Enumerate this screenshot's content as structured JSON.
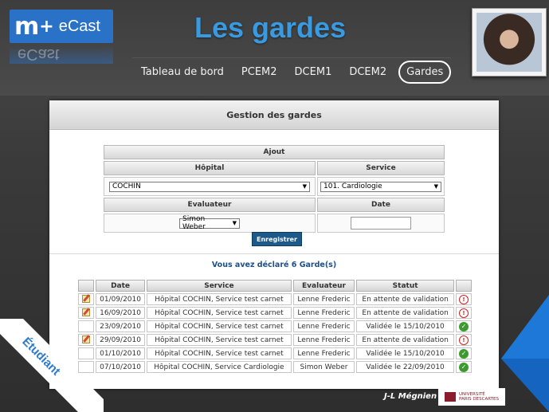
{
  "header": {
    "logo_text": "eCast",
    "slide_title": "Les gardes"
  },
  "nav": {
    "items": [
      {
        "label": "Tableau de bord",
        "active": false
      },
      {
        "label": "PCEM2",
        "active": false
      },
      {
        "label": "DCEM1",
        "active": false
      },
      {
        "label": "DCEM2",
        "active": false
      },
      {
        "label": "Gardes",
        "active": true
      }
    ]
  },
  "panel": {
    "title": "Gestion des gardes",
    "form": {
      "section_title": "Ajout",
      "hospital_label": "Hôpital",
      "hospital_value": "COCHIN",
      "service_label": "Service",
      "service_value": "101. Cardiologie",
      "evaluator_label": "Evaluateur",
      "evaluator_value": "Simon Weber",
      "date_label": "Date",
      "date_value": "",
      "save_label": "Enregistrer"
    },
    "declared_text": "Vous avez déclaré 6 Garde(s)",
    "table": {
      "headers": [
        "",
        "Date",
        "Service",
        "Evaluateur",
        "Statut",
        ""
      ],
      "rows": [
        {
          "editable": true,
          "date": "01/09/2010",
          "service": "Hôpital COCHIN, Service test carnet",
          "evaluator": "Lenne Frederic",
          "status": "En attente de validation",
          "status_type": "pending"
        },
        {
          "editable": true,
          "date": "16/09/2010",
          "service": "Hôpital COCHIN, Service test carnet",
          "evaluator": "Lenne Frederic",
          "status": "En attente de validation",
          "status_type": "pending"
        },
        {
          "editable": false,
          "date": "23/09/2010",
          "service": "Hôpital COCHIN, Service test carnet",
          "evaluator": "Lenne Frederic",
          "status": "Validée le 15/10/2010",
          "status_type": "validated"
        },
        {
          "editable": true,
          "date": "29/09/2010",
          "service": "Hôpital COCHIN, Service test carnet",
          "evaluator": "Lenne Frederic",
          "status": "En attente de validation",
          "status_type": "pending"
        },
        {
          "editable": false,
          "date": "01/10/2010",
          "service": "Hôpital COCHIN, Service test carnet",
          "evaluator": "Lenne Frederic",
          "status": "Validée le 15/10/2010",
          "status_type": "validated"
        },
        {
          "editable": false,
          "date": "07/10/2010",
          "service": "Hôpital COCHIN, Service Cardiologie",
          "evaluator": "Simon Weber",
          "status": "Validée le 22/09/2010",
          "status_type": "validated"
        }
      ]
    }
  },
  "footer": {
    "author": "J-L Mégnien",
    "university_line1": "UNIVERSITÉ",
    "university_line2": "PARIS DESCARTES",
    "ribbon_label": "Étudiant"
  },
  "colors": {
    "accent_blue": "#3a9ae0",
    "pending_red": "#d62020",
    "validated_green": "#3c9a2f",
    "button_blue": "#1d5a8c"
  }
}
